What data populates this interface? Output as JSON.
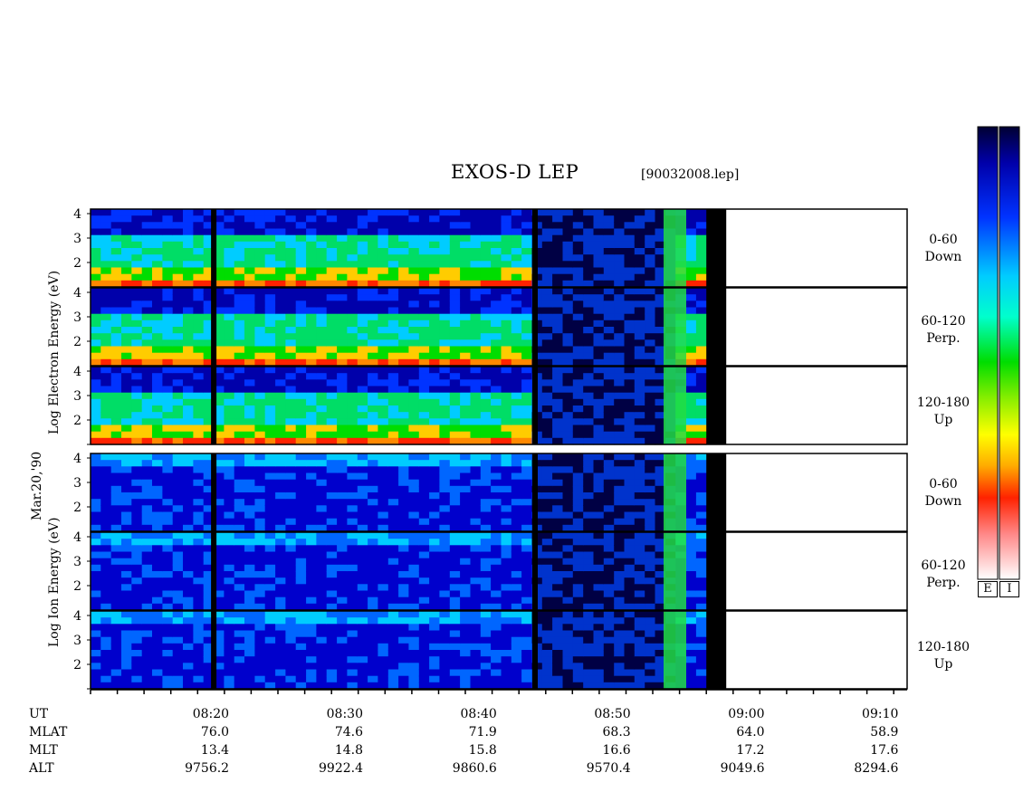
{
  "title": "EXOS-D LEP",
  "file_label": "[90032008.lep]",
  "date_label": "Mar.20,'90",
  "electron_label": "Log   Electron   Energy  (eV)",
  "ion_label": "Log    Ion   Energy  (eV)",
  "panel_labels": [
    {
      "angle": "0-60",
      "dir": "Down"
    },
    {
      "angle": "60-120",
      "dir": "Perp."
    },
    {
      "angle": "120-180",
      "dir": "Up"
    },
    {
      "angle": "0-60",
      "dir": "Down"
    },
    {
      "angle": "60-120",
      "dir": "Perp."
    },
    {
      "angle": "120-180",
      "dir": "Up"
    }
  ],
  "colorbar_labels": [
    "E",
    "I"
  ],
  "colors": {
    "scale": [
      "#ffffff",
      "#ff9999",
      "#ff0000",
      "#ff8800",
      "#ffff00",
      "#00cc00",
      "#00ffff",
      "#0066ff",
      "#0000aa",
      "#000033"
    ]
  },
  "chart_data": {
    "type": "heatmap",
    "title": "EXOS-D LEP",
    "ylabel_electron": "Log Electron Energy (eV)",
    "ylabel_ion": "Log Ion Energy (eV)",
    "y_ticks": [
      "4",
      "3",
      "2"
    ],
    "y_ticks_last": [
      "4",
      "3",
      "2",
      "1"
    ],
    "time_range": [
      "08:11",
      "09:12"
    ],
    "data_end": "08:57",
    "gaps": [
      "08:20",
      "08:44"
    ],
    "rows": [
      "UT",
      "MLAT",
      "MLT",
      "ALT"
    ],
    "ticks": [
      {
        "ut": "08:20",
        "mlat": "76.0",
        "mlt": "13.4",
        "alt": "9756.2"
      },
      {
        "ut": "08:30",
        "mlat": "74.6",
        "mlt": "14.8",
        "alt": "9922.4"
      },
      {
        "ut": "08:40",
        "mlat": "71.9",
        "mlt": "15.8",
        "alt": "9860.6"
      },
      {
        "ut": "08:50",
        "mlat": "68.3",
        "mlt": "16.6",
        "alt": "9570.4"
      },
      {
        "ut": "09:00",
        "mlat": "64.0",
        "mlt": "17.2",
        "alt": "9049.6"
      },
      {
        "ut": "09:10",
        "mlat": "58.9",
        "mlt": "17.6",
        "alt": "8294.6"
      }
    ]
  }
}
